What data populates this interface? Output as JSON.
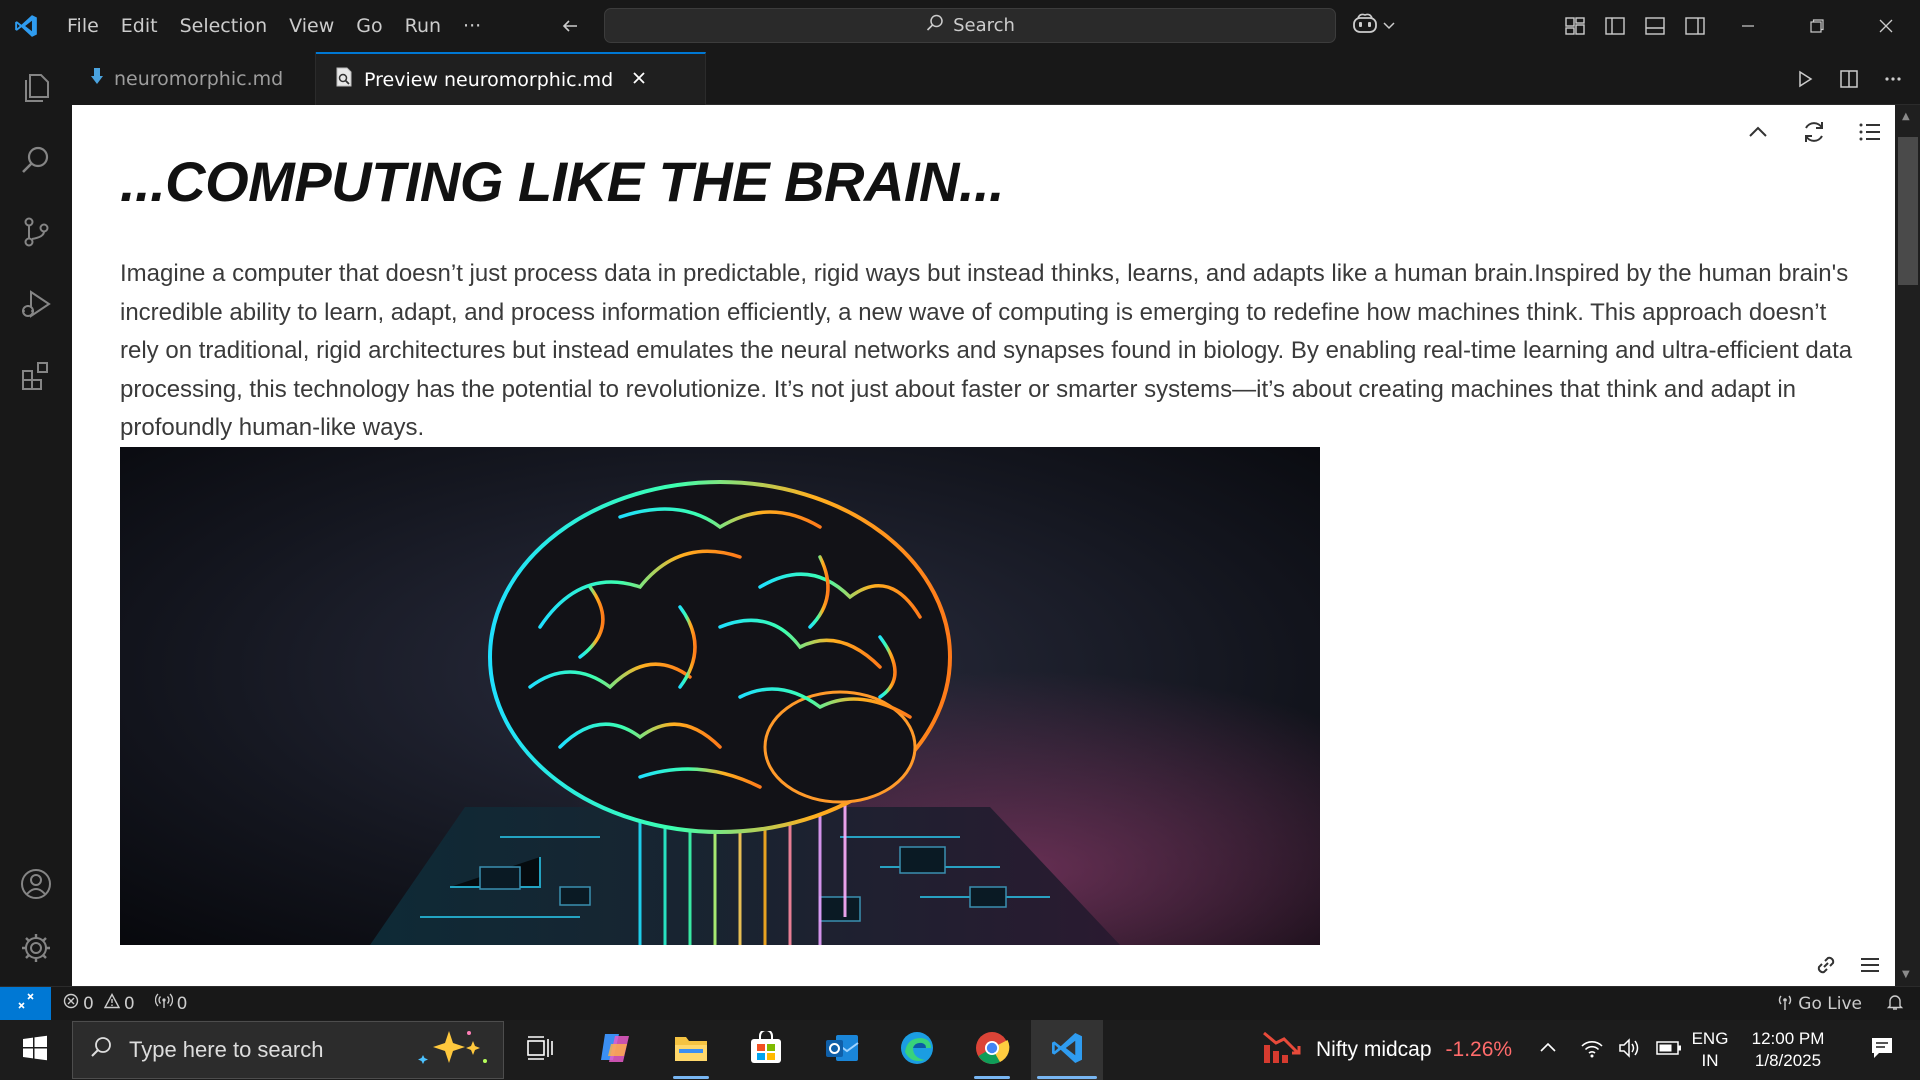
{
  "titlebar": {
    "menu": [
      "File",
      "Edit",
      "Selection",
      "View",
      "Go",
      "Run",
      "···"
    ],
    "search_label": "Search"
  },
  "tabs": [
    {
      "label": "neuromorphic.md",
      "icon": "markdown-icon"
    },
    {
      "label": "Preview neuromorphic.md",
      "icon": "preview-icon"
    }
  ],
  "preview": {
    "heading": "...COMPUTING LIKE THE BRAIN...",
    "paragraph": "Imagine a computer that doesn’t just process data in predictable, rigid ways but instead thinks, learns, and adapts like a human brain.Inspired by the human brain's incredible ability to learn, adapt, and process information efficiently, a new wave of computing is emerging to redefine how machines think. This approach doesn’t rely on traditional, rigid architectures but instead emulates the neural networks and synapses found in biology. By enabling real-time learning and ultra-efficient data processing, this technology has the potential to revolutionize. It’s not just about faster or smarter systems—it’s about creating machines that think and adapt in profoundly human-like ways.",
    "image_subject": "glowing brain on circuit board"
  },
  "statusbar": {
    "errors": "0",
    "warnings": "0",
    "ports": "0",
    "go_live": "Go Live"
  },
  "taskbar": {
    "search_placeholder": "Type here to search",
    "stock_name": "Nifty midcap",
    "stock_change": "-1.26%",
    "lang_top": "ENG",
    "lang_bottom": "IN",
    "time": "12:00 PM",
    "date": "1/8/2025"
  },
  "colors": {
    "accent": "#0078d4",
    "editor_bg": "#1f1f1f",
    "chrome_bg": "#181818",
    "stock_negative": "#ff6b6b"
  }
}
